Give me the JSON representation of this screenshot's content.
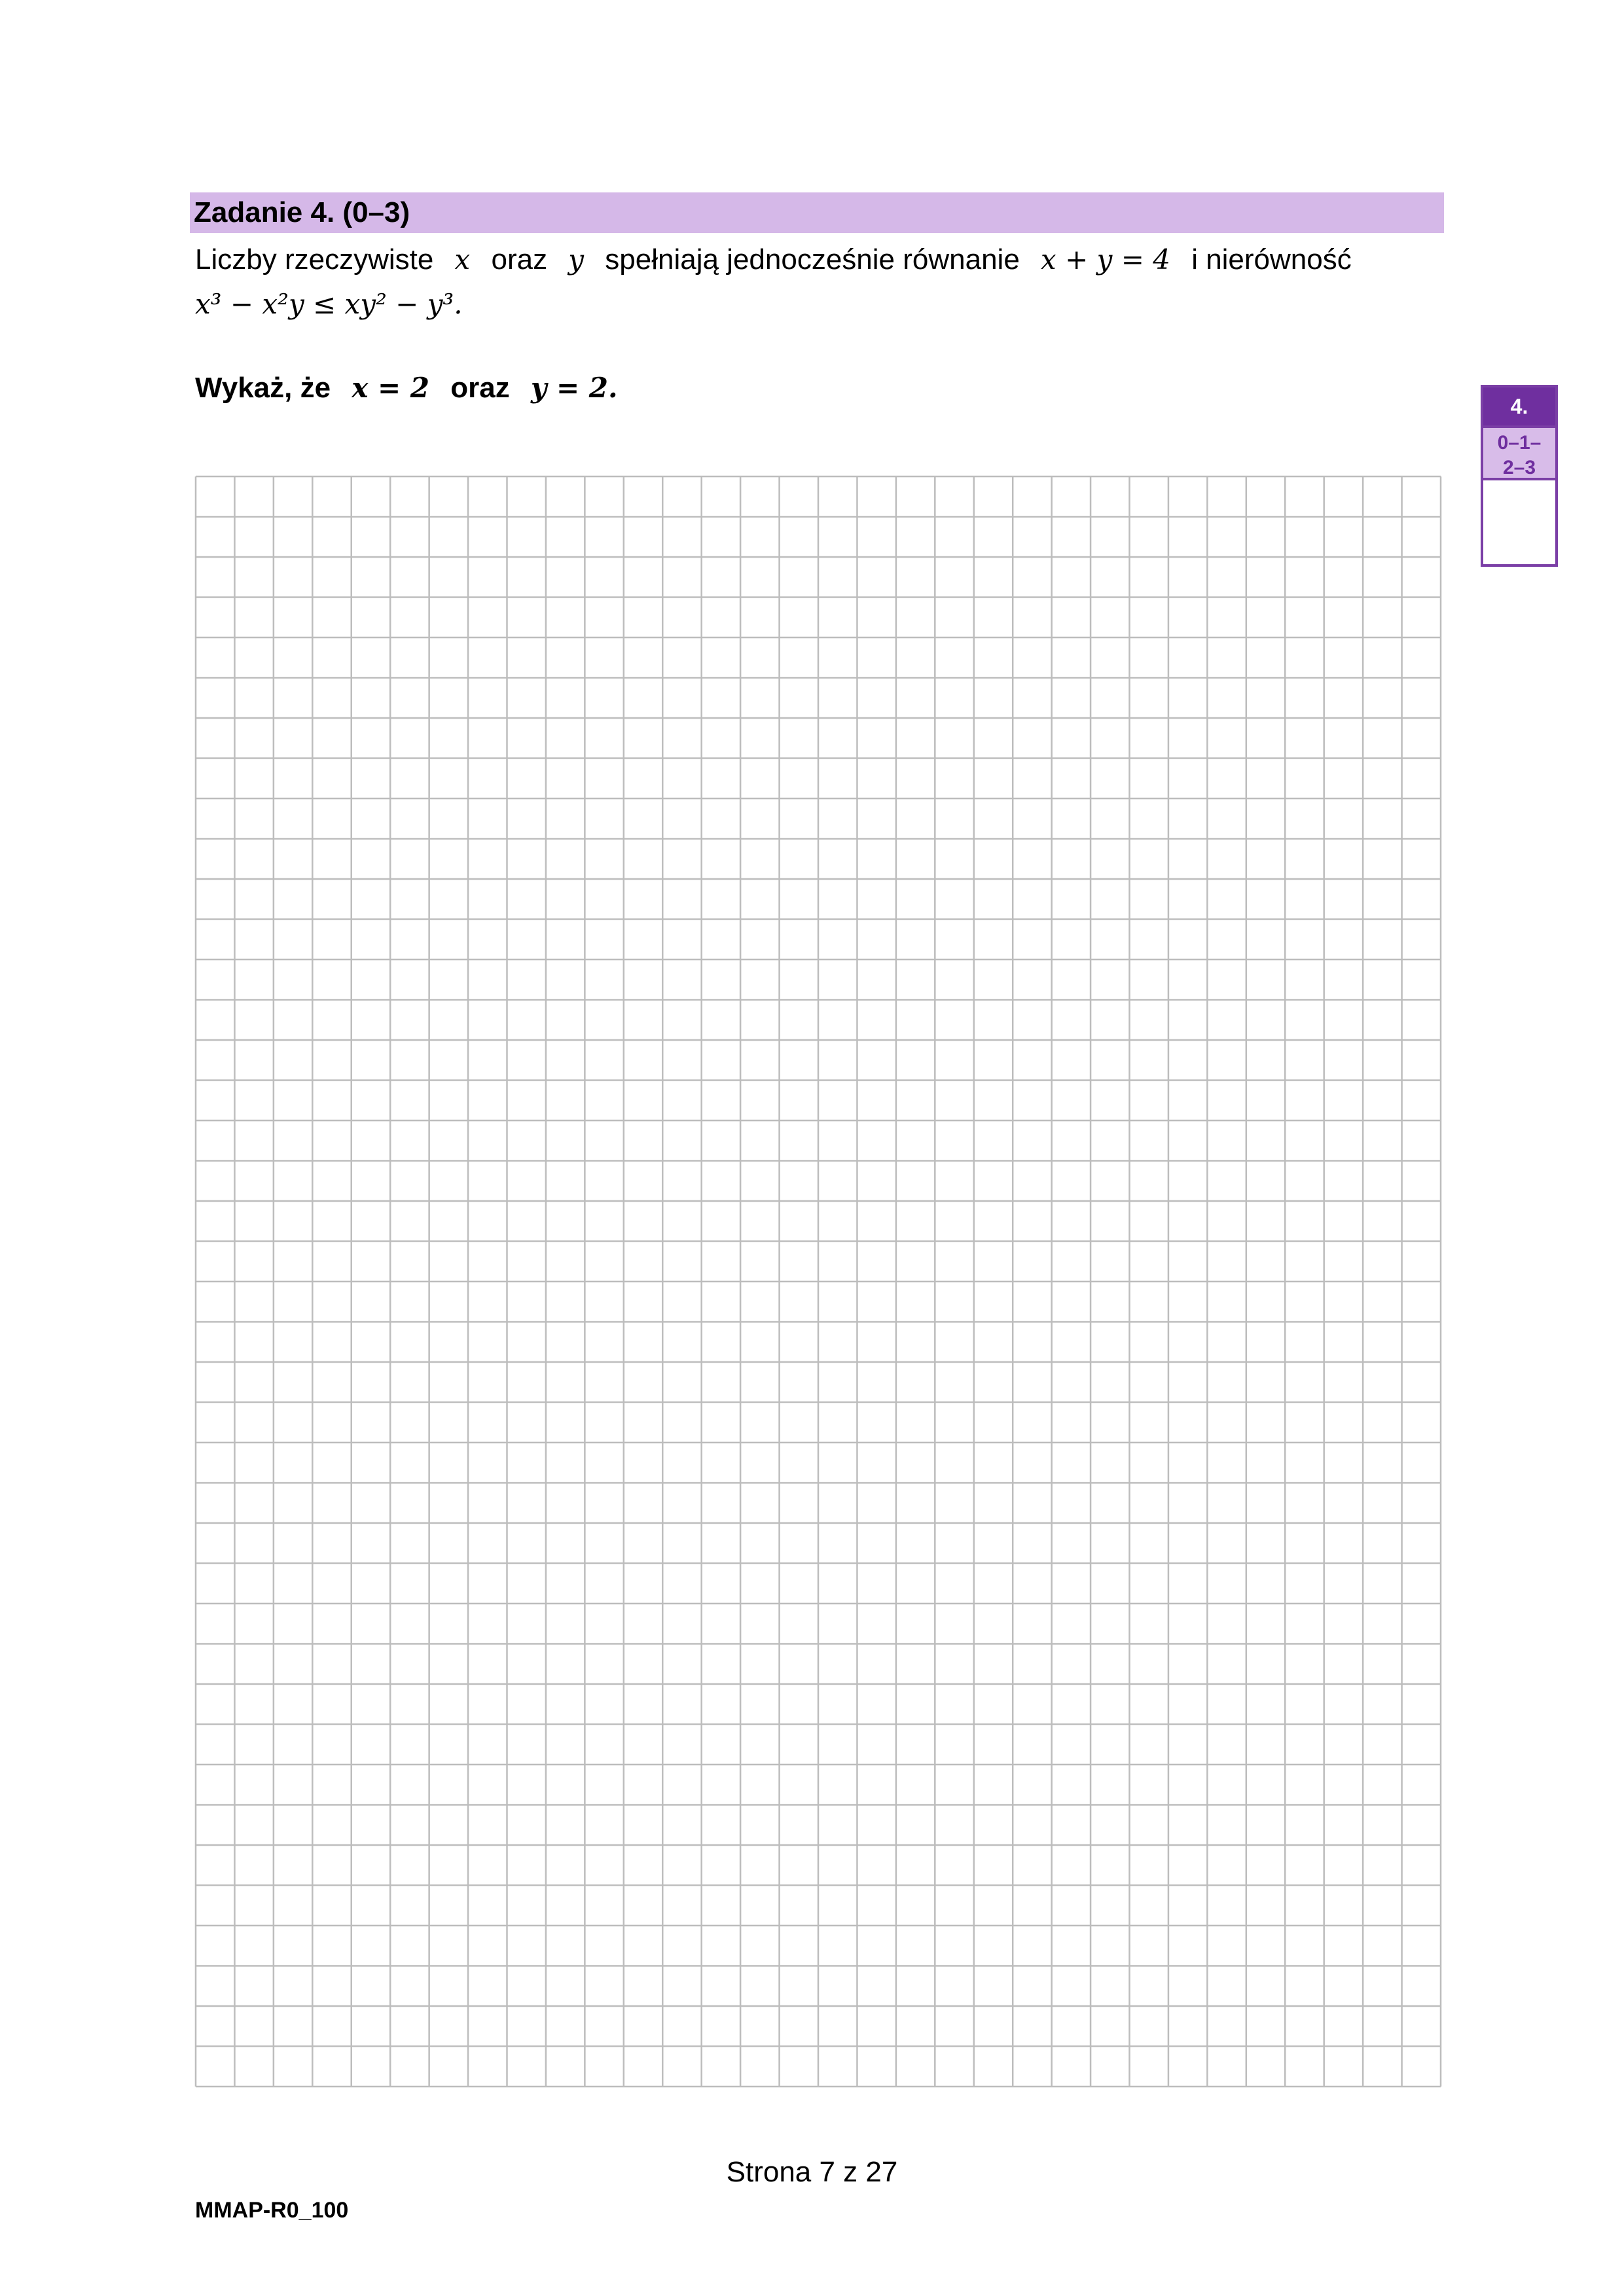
{
  "task": {
    "title": "Zadanie 4. (0–3)",
    "line1_text_a": "Liczby rzeczywiste",
    "var_x": "x",
    "word_oraz": "oraz",
    "var_y": "y",
    "line1_text_b": "spełniają jednocześnie równanie",
    "equation": "x + y = 4",
    "line1_text_c": "i nierówność",
    "inequality": "x³ − x²y ≤ xy² − y³.",
    "instruction_a": "Wykaż, że",
    "instruction_eq1": "x = 2",
    "instruction_oraz": "oraz",
    "instruction_eq2": "y = 2."
  },
  "score_box": {
    "number": "4.",
    "range_line1": "0–1–",
    "range_line2": "2–3"
  },
  "grid": {
    "columns": 32,
    "rows": 40,
    "line_color": "#bdbdbd"
  },
  "footer": {
    "page": "Strona 7 z 27",
    "code": "MMAP-R0_100"
  },
  "colors": {
    "header_bg": "#d5b8e8",
    "accent": "#6f2f9f"
  }
}
